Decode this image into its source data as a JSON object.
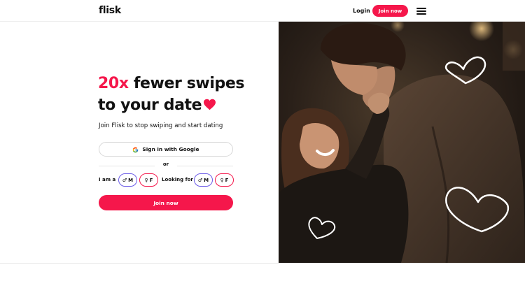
{
  "header": {
    "logo": "flisk",
    "login_label": "Login",
    "join_label": "Join now"
  },
  "hero": {
    "headline_accent": "20x",
    "headline_rest": " fewer swipes",
    "headline_line2": "to your date",
    "subtitle": "Join Flisk to stop swiping and start dating",
    "google_button": "Sign in with Google",
    "or_label": "or",
    "i_am_label": "I am a",
    "looking_for_label": "Looking for",
    "male_option": "M",
    "female_option": "F",
    "join_button": "Join now"
  },
  "colors": {
    "accent": "#f5174b",
    "male_outline": "#6c5ce7"
  },
  "icons": [
    "google-icon",
    "male-symbol-icon",
    "female-symbol-icon",
    "heart-icon",
    "hamburger-menu-icon"
  ]
}
